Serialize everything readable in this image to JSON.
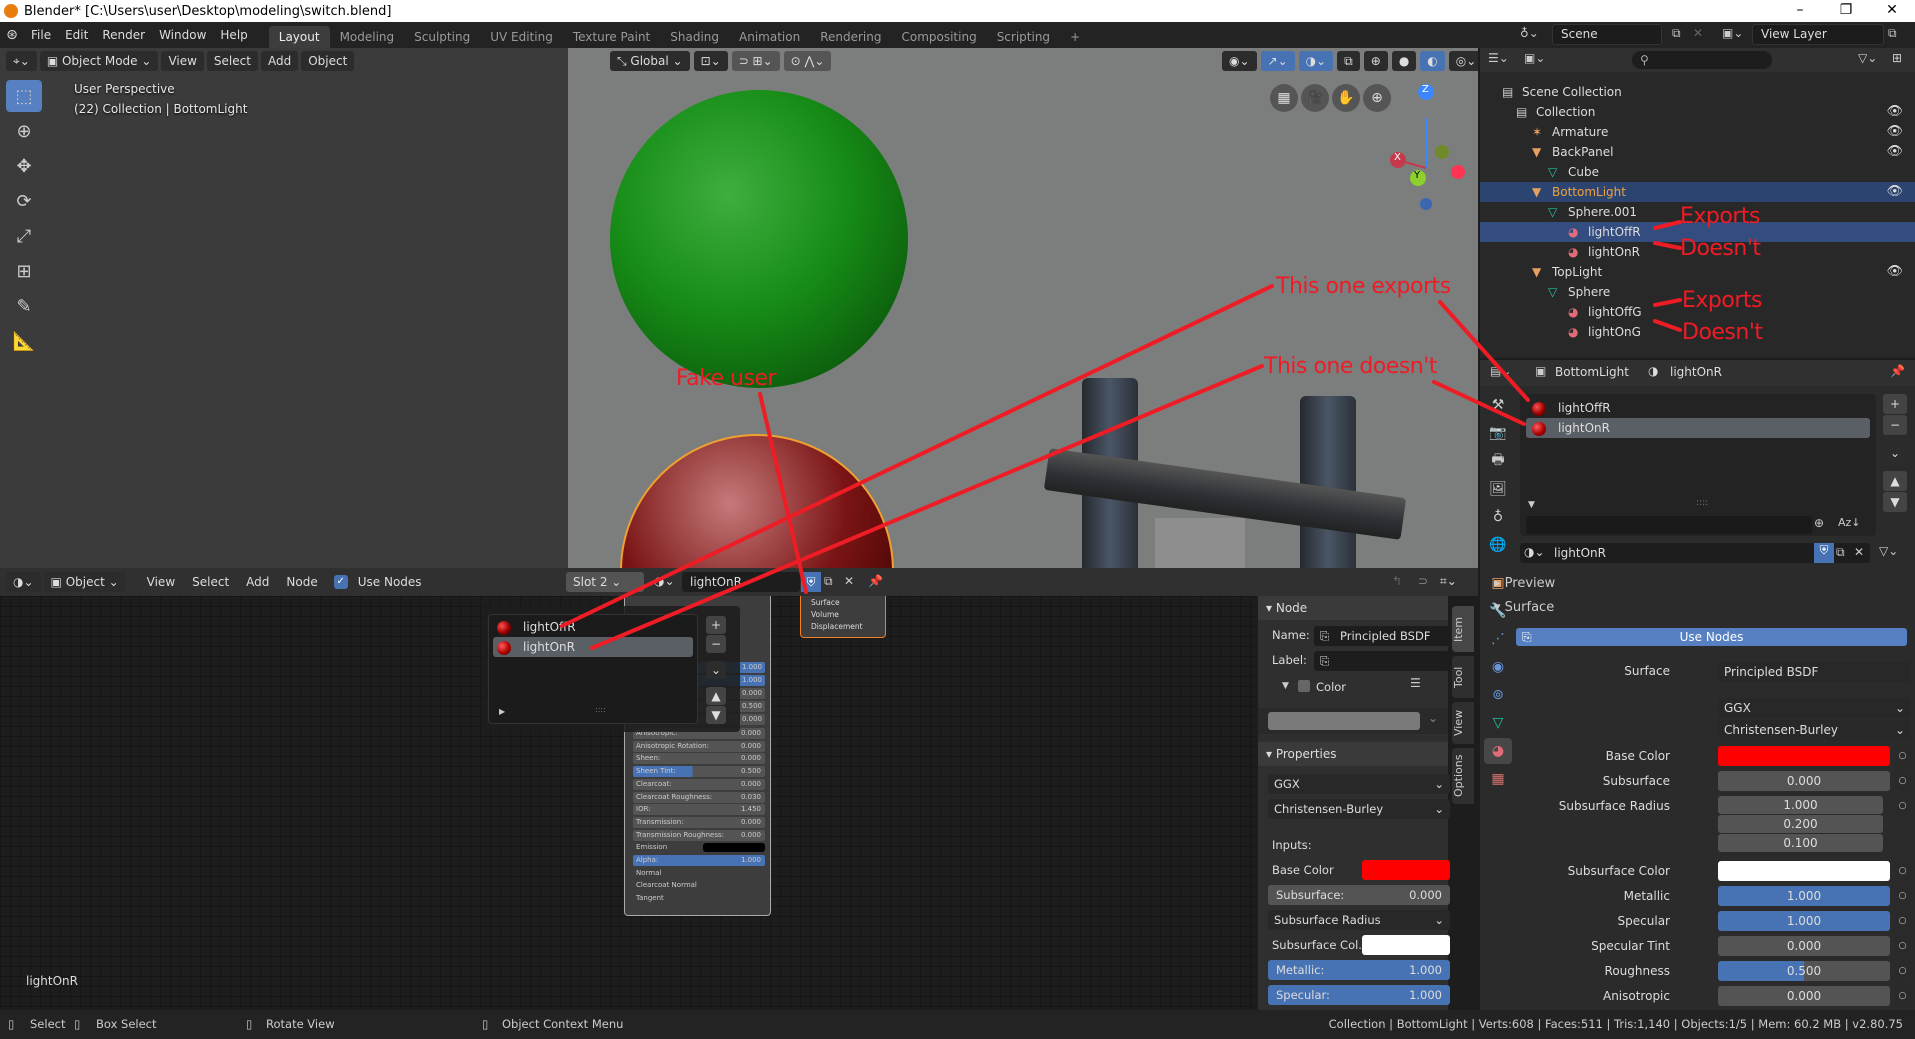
{
  "window": {
    "title": "Blender* [C:\\Users\\user\\Desktop\\modeling\\switch.blend]",
    "controls": {
      "minimize": "–",
      "maximize": "❐",
      "close": "✕"
    }
  },
  "topbar": {
    "menus": [
      "File",
      "Edit",
      "Render",
      "Window",
      "Help"
    ],
    "workspaces": [
      "Layout",
      "Modeling",
      "Sculpting",
      "UV Editing",
      "Texture Paint",
      "Shading",
      "Animation",
      "Rendering",
      "Compositing",
      "Scripting"
    ],
    "active_workspace": "Layout",
    "add_workspace": "+",
    "scene": "Scene",
    "view_layer": "View Layer"
  },
  "viewport": {
    "mode": "Object Mode",
    "menus": [
      "View",
      "Select",
      "Add",
      "Object"
    ],
    "orientation": "Global",
    "overlay_title": "User Perspective",
    "overlay_subtitle": "(22) Collection | BottomLight",
    "gizmo_axes": {
      "x": "X",
      "y": "Y",
      "z": "Z"
    }
  },
  "annotations": {
    "fake_user": "Fake user",
    "this_one_exports": "This one exports",
    "this_one_doesnt": "This one doesn't",
    "exports_1": "Exports",
    "doesnt_1": "Doesn't",
    "exports_2": "Exports",
    "doesnt_2": "Doesn't",
    "color": "#ee1c25"
  },
  "outliner": {
    "search_placeholder": "",
    "items": [
      {
        "label": "Scene Collection",
        "icon": "scene-collection-icon"
      },
      {
        "label": "Collection",
        "icon": "collection-icon",
        "visible": true
      },
      {
        "label": "Armature",
        "icon": "armature-icon",
        "visible": true
      },
      {
        "label": "BackPanel",
        "icon": "object-icon",
        "visible": true
      },
      {
        "label": "Cube",
        "icon": "mesh-icon"
      },
      {
        "label": "BottomLight",
        "icon": "object-icon",
        "visible": true,
        "selected": true
      },
      {
        "label": "Sphere.001",
        "icon": "mesh-icon"
      },
      {
        "label": "lightOffR",
        "icon": "material-icon",
        "selected": true
      },
      {
        "label": "lightOnR",
        "icon": "material-icon"
      },
      {
        "label": "TopLight",
        "icon": "object-icon",
        "visible": true
      },
      {
        "label": "Sphere",
        "icon": "mesh-icon"
      },
      {
        "label": "lightOffG",
        "icon": "material-icon"
      },
      {
        "label": "lightOnG",
        "icon": "material-icon"
      }
    ]
  },
  "properties": {
    "breadcrumb_object": "BottomLight",
    "breadcrumb_material": "lightOnR",
    "slots": [
      "lightOffR",
      "lightOnR"
    ],
    "active_slot": "lightOnR",
    "material_name": "lightOnR",
    "sections": {
      "preview": "Preview",
      "surface": "Surface"
    },
    "use_nodes_label": "Use Nodes",
    "surface_label": "Surface",
    "surface_value": "Principled BSDF",
    "distribution": "GGX",
    "subsurface_method": "Christensen-Burley",
    "fields": [
      {
        "label": "Base Color",
        "type": "color",
        "color": "#ff0000"
      },
      {
        "label": "Subsurface",
        "value": "0.000",
        "fraction": 0
      },
      {
        "label": "Subsurface Radius",
        "values": [
          "1.000",
          "0.200",
          "0.100"
        ]
      },
      {
        "label": "Subsurface Color",
        "type": "color",
        "color": "#ffffff"
      },
      {
        "label": "Metallic",
        "value": "1.000",
        "fraction": 1
      },
      {
        "label": "Specular",
        "value": "1.000",
        "fraction": 1
      },
      {
        "label": "Specular Tint",
        "value": "0.000",
        "fraction": 0
      },
      {
        "label": "Roughness",
        "value": "0.500",
        "fraction": 0.5
      },
      {
        "label": "Anisotropic",
        "value": "0.000",
        "fraction": 0
      }
    ]
  },
  "node_editor": {
    "object_type": "Object",
    "menus": [
      "View",
      "Select",
      "Add",
      "Node"
    ],
    "use_nodes_label": "Use Nodes",
    "use_nodes_checked": true,
    "slot": "Slot 2",
    "material_name": "lightOnR",
    "material_label_bottom": "lightOnR",
    "popup_slots": [
      "lightOffR",
      "lightOnR"
    ],
    "output_node_sockets": [
      "Surface",
      "Volume",
      "Displacement"
    ],
    "bsdf_rows": [
      {
        "label": "Anisotropic:",
        "value": "0.000"
      },
      {
        "label": "Anisotropic Rotation:",
        "value": "0.000"
      },
      {
        "label": "Sheen:",
        "value": "0.000"
      },
      {
        "label": "Sheen Tint:",
        "value": "0.500"
      },
      {
        "label": "Clearcoat:",
        "value": "0.000"
      },
      {
        "label": "Clearcoat Roughness:",
        "value": "0.030"
      },
      {
        "label": "IOR:",
        "value": "1.450"
      },
      {
        "label": "Transmission:",
        "value": "0.000"
      },
      {
        "label": "Transmission Roughness:",
        "value": "0.000"
      },
      {
        "label": "Emission",
        "value": ""
      },
      {
        "label": "Alpha:",
        "value": "1.000"
      },
      {
        "label": "Normal",
        "value": ""
      },
      {
        "label": "Clearcoat Normal",
        "value": ""
      },
      {
        "label": "Tangent",
        "value": ""
      }
    ],
    "bsdf_values_top": [
      "1.000",
      "1.000",
      "0.000",
      "0.500",
      "0.000"
    ],
    "sidebar": {
      "tabs": [
        "Item",
        "Tool",
        "View",
        "Options"
      ],
      "node_section": "Node",
      "name_label": "Name:",
      "name_value": "Principled BSDF",
      "label_label": "Label:",
      "label_value": "",
      "color_label": "Color",
      "properties_section": "Properties",
      "distribution": "GGX",
      "subsurface_method": "Christensen-Burley",
      "inputs_label": "Inputs:",
      "base_color_label": "Base Color",
      "subsurface_label": "Subsurface:",
      "subsurface_value": "0.000",
      "subsurface_radius_label": "Subsurface Radius",
      "subsurface_color_label": "Subsurface Col..",
      "metallic_label": "Metallic:",
      "metallic_value": "1.000",
      "specular_label": "Specular:",
      "specular_value": "1.000"
    }
  },
  "statusbar": {
    "hints": [
      "Select",
      "Box Select",
      "Rotate View",
      "Object Context Menu"
    ],
    "info": "Collection | BottomLight | Verts:608 | Faces:511 | Tris:1,140 | Objects:1/5 | Mem: 60.2 MB | v2.80.75"
  }
}
